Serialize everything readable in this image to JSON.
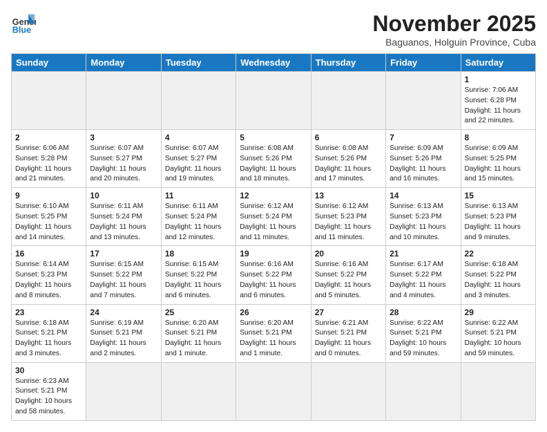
{
  "header": {
    "logo_general": "General",
    "logo_blue": "Blue",
    "month": "November 2025",
    "location": "Baguanos, Holguin Province, Cuba"
  },
  "weekdays": [
    "Sunday",
    "Monday",
    "Tuesday",
    "Wednesday",
    "Thursday",
    "Friday",
    "Saturday"
  ],
  "weeks": [
    [
      {
        "day": "",
        "info": "",
        "empty": true
      },
      {
        "day": "",
        "info": "",
        "empty": true
      },
      {
        "day": "",
        "info": "",
        "empty": true
      },
      {
        "day": "",
        "info": "",
        "empty": true
      },
      {
        "day": "",
        "info": "",
        "empty": true
      },
      {
        "day": "",
        "info": "",
        "empty": true
      },
      {
        "day": "1",
        "info": "Sunrise: 7:06 AM\nSunset: 6:28 PM\nDaylight: 11 hours\nand 22 minutes."
      }
    ],
    [
      {
        "day": "2",
        "info": "Sunrise: 6:06 AM\nSunset: 5:28 PM\nDaylight: 11 hours\nand 21 minutes."
      },
      {
        "day": "3",
        "info": "Sunrise: 6:07 AM\nSunset: 5:27 PM\nDaylight: 11 hours\nand 20 minutes."
      },
      {
        "day": "4",
        "info": "Sunrise: 6:07 AM\nSunset: 5:27 PM\nDaylight: 11 hours\nand 19 minutes."
      },
      {
        "day": "5",
        "info": "Sunrise: 6:08 AM\nSunset: 5:26 PM\nDaylight: 11 hours\nand 18 minutes."
      },
      {
        "day": "6",
        "info": "Sunrise: 6:08 AM\nSunset: 5:26 PM\nDaylight: 11 hours\nand 17 minutes."
      },
      {
        "day": "7",
        "info": "Sunrise: 6:09 AM\nSunset: 5:26 PM\nDaylight: 11 hours\nand 16 minutes."
      },
      {
        "day": "8",
        "info": "Sunrise: 6:09 AM\nSunset: 5:25 PM\nDaylight: 11 hours\nand 15 minutes."
      }
    ],
    [
      {
        "day": "9",
        "info": "Sunrise: 6:10 AM\nSunset: 5:25 PM\nDaylight: 11 hours\nand 14 minutes."
      },
      {
        "day": "10",
        "info": "Sunrise: 6:11 AM\nSunset: 5:24 PM\nDaylight: 11 hours\nand 13 minutes."
      },
      {
        "day": "11",
        "info": "Sunrise: 6:11 AM\nSunset: 5:24 PM\nDaylight: 11 hours\nand 12 minutes."
      },
      {
        "day": "12",
        "info": "Sunrise: 6:12 AM\nSunset: 5:24 PM\nDaylight: 11 hours\nand 11 minutes."
      },
      {
        "day": "13",
        "info": "Sunrise: 6:12 AM\nSunset: 5:23 PM\nDaylight: 11 hours\nand 11 minutes."
      },
      {
        "day": "14",
        "info": "Sunrise: 6:13 AM\nSunset: 5:23 PM\nDaylight: 11 hours\nand 10 minutes."
      },
      {
        "day": "15",
        "info": "Sunrise: 6:13 AM\nSunset: 5:23 PM\nDaylight: 11 hours\nand 9 minutes."
      }
    ],
    [
      {
        "day": "16",
        "info": "Sunrise: 6:14 AM\nSunset: 5:23 PM\nDaylight: 11 hours\nand 8 minutes."
      },
      {
        "day": "17",
        "info": "Sunrise: 6:15 AM\nSunset: 5:22 PM\nDaylight: 11 hours\nand 7 minutes."
      },
      {
        "day": "18",
        "info": "Sunrise: 6:15 AM\nSunset: 5:22 PM\nDaylight: 11 hours\nand 6 minutes."
      },
      {
        "day": "19",
        "info": "Sunrise: 6:16 AM\nSunset: 5:22 PM\nDaylight: 11 hours\nand 6 minutes."
      },
      {
        "day": "20",
        "info": "Sunrise: 6:16 AM\nSunset: 5:22 PM\nDaylight: 11 hours\nand 5 minutes."
      },
      {
        "day": "21",
        "info": "Sunrise: 6:17 AM\nSunset: 5:22 PM\nDaylight: 11 hours\nand 4 minutes."
      },
      {
        "day": "22",
        "info": "Sunrise: 6:18 AM\nSunset: 5:22 PM\nDaylight: 11 hours\nand 3 minutes."
      }
    ],
    [
      {
        "day": "23",
        "info": "Sunrise: 6:18 AM\nSunset: 5:21 PM\nDaylight: 11 hours\nand 3 minutes."
      },
      {
        "day": "24",
        "info": "Sunrise: 6:19 AM\nSunset: 5:21 PM\nDaylight: 11 hours\nand 2 minutes."
      },
      {
        "day": "25",
        "info": "Sunrise: 6:20 AM\nSunset: 5:21 PM\nDaylight: 11 hours\nand 1 minute."
      },
      {
        "day": "26",
        "info": "Sunrise: 6:20 AM\nSunset: 5:21 PM\nDaylight: 11 hours\nand 1 minute."
      },
      {
        "day": "27",
        "info": "Sunrise: 6:21 AM\nSunset: 5:21 PM\nDaylight: 11 hours\nand 0 minutes."
      },
      {
        "day": "28",
        "info": "Sunrise: 6:22 AM\nSunset: 5:21 PM\nDaylight: 10 hours\nand 59 minutes."
      },
      {
        "day": "29",
        "info": "Sunrise: 6:22 AM\nSunset: 5:21 PM\nDaylight: 10 hours\nand 59 minutes."
      }
    ],
    [
      {
        "day": "30",
        "info": "Sunrise: 6:23 AM\nSunset: 5:21 PM\nDaylight: 10 hours\nand 58 minutes."
      },
      {
        "day": "",
        "info": "",
        "empty": true
      },
      {
        "day": "",
        "info": "",
        "empty": true
      },
      {
        "day": "",
        "info": "",
        "empty": true
      },
      {
        "day": "",
        "info": "",
        "empty": true
      },
      {
        "day": "",
        "info": "",
        "empty": true
      },
      {
        "day": "",
        "info": "",
        "empty": true
      }
    ]
  ]
}
